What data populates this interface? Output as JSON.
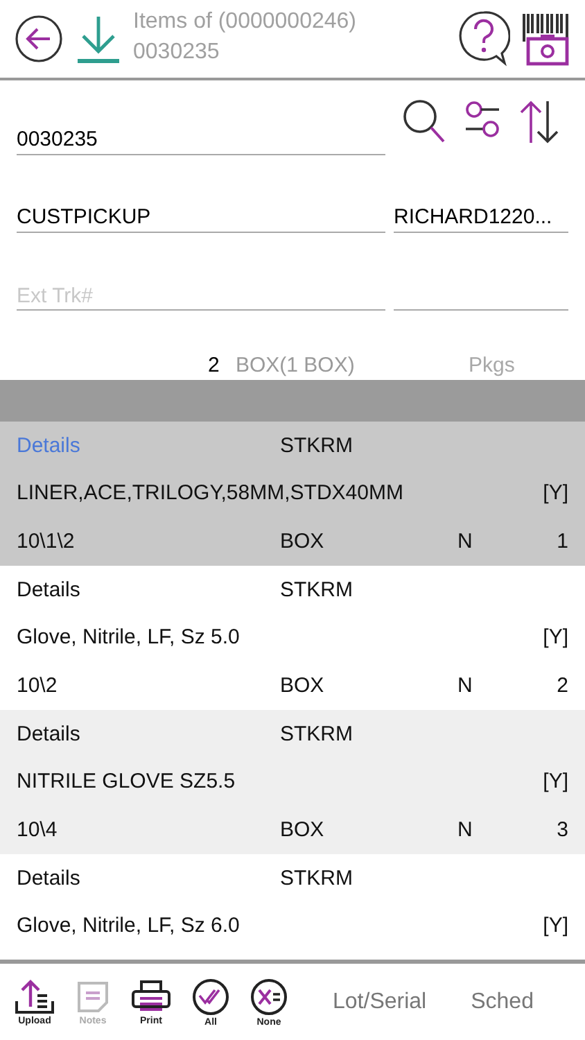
{
  "header": {
    "title": "Items of (0000000246)",
    "subtitle": "0030235"
  },
  "fields": {
    "order": {
      "value": "0030235"
    },
    "ship_via": {
      "value": "CUSTPICKUP"
    },
    "account": {
      "value": "RICHARD1220..."
    },
    "ext_trk": {
      "placeholder": "Ext Trk#"
    },
    "packages": {
      "count": "2",
      "unit": "BOX(1 BOX)",
      "placeholder": "Pkgs"
    }
  },
  "items": [
    {
      "details": "Details",
      "location_code": "STKRM",
      "description": "LINER,ACE,TRILOGY,58MM,STDX40MM",
      "flag": "[Y]",
      "bin": "10\\1\\2",
      "uom": "BOX",
      "status": "N",
      "line": "1",
      "selected": true
    },
    {
      "details": "Details",
      "location_code": "STKRM",
      "description": "Glove, Nitrile, LF, Sz 5.0",
      "flag": "[Y]",
      "bin": "10\\2",
      "uom": "BOX",
      "status": "N",
      "line": "2",
      "selected": false
    },
    {
      "details": "Details",
      "location_code": "STKRM",
      "description": "NITRILE GLOVE SZ5.5",
      "flag": "[Y]",
      "bin": "10\\4",
      "uom": "BOX",
      "status": "N",
      "line": "3",
      "selected": false
    },
    {
      "details": "Details",
      "location_code": "STKRM",
      "description": "Glove, Nitrile, LF, Sz 6.0",
      "flag": "[Y]",
      "selected": false
    }
  ],
  "toolbar": [
    {
      "kind": "upload",
      "label": "Upload",
      "disabled": false
    },
    {
      "kind": "notes",
      "label": "Notes",
      "disabled": true
    },
    {
      "kind": "print",
      "label": "Print",
      "disabled": false
    },
    {
      "kind": "all",
      "label": "All",
      "disabled": false
    },
    {
      "kind": "none",
      "label": "None",
      "disabled": false
    },
    {
      "kind": "text",
      "label": "Lot/Serial",
      "disabled": false
    },
    {
      "kind": "text",
      "label": "Sched",
      "disabled": false
    }
  ]
}
